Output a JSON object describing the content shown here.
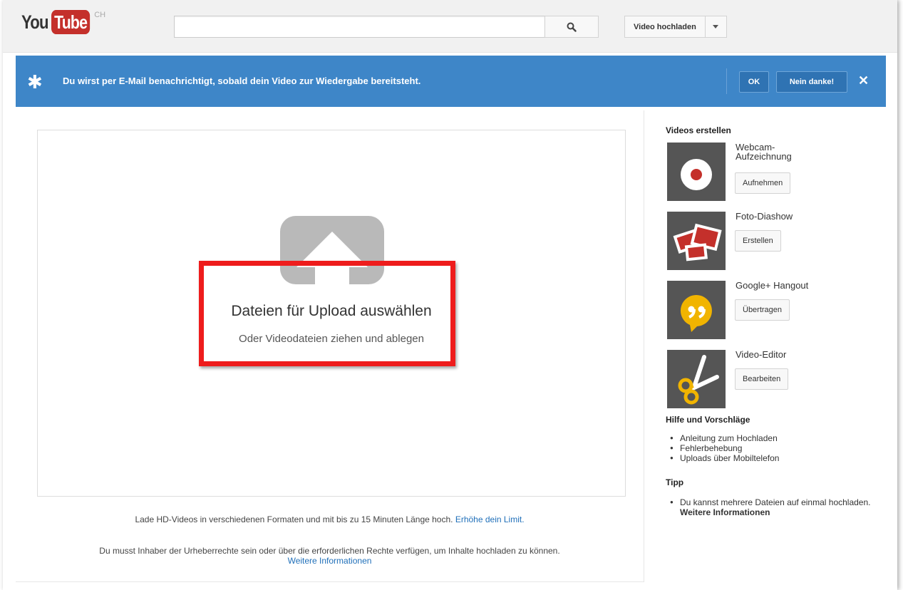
{
  "header": {
    "logo_you": "You",
    "logo_tube": "Tube",
    "logo_country": "CH",
    "search_value": "",
    "upload_button": "Video hochladen"
  },
  "banner": {
    "message": "Du wirst per E-Mail benachrichtigt, sobald dein Video zur Wiedergabe bereitsteht.",
    "ok_label": "OK",
    "decline_label": "Nein danke!",
    "close_label": "✕",
    "background_color": "#3e86c8"
  },
  "upload": {
    "select_title": "Dateien für Upload auswählen",
    "drag_hint": "Oder Videodateien ziehen und ablegen",
    "hd_info": "Lade HD-Videos in verschiedenen Formaten und mit bis zu 15 Minuten Länge hoch.",
    "limit_link": "Erhöhe dein Limit.",
    "rights_info": "Du musst Inhaber der Urheberrechte sein oder über die erforderlichen Rechte verfügen, um Inhalte hochladen zu können.",
    "more_info_link": "Weitere Informationen",
    "highlight_color": "#ee1c1c"
  },
  "sidebar": {
    "create_heading": "Videos erstellen",
    "tools": [
      {
        "name": "Webcam-\nAufzeichnung",
        "button": "Aufnehmen",
        "icon": "record-icon"
      },
      {
        "name": "Foto-Diashow",
        "button": "Erstellen",
        "icon": "photo-slideshow-icon"
      },
      {
        "name": "Google+ Hangout",
        "button": "Übertragen",
        "icon": "hangout-icon"
      },
      {
        "name": "Video-Editor",
        "button": "Bearbeiten",
        "icon": "scissors-icon"
      }
    ],
    "help_heading": "Hilfe und Vorschläge",
    "help_links": [
      "Anleitung zum Hochladen",
      "Fehlerbehebung",
      "Uploads über Mobiltelefon"
    ],
    "tip_heading": "Tipp",
    "tip_text": "Du kannst mehrere Dateien auf einmal hochladen.",
    "tip_link": "Weitere Informationen"
  }
}
